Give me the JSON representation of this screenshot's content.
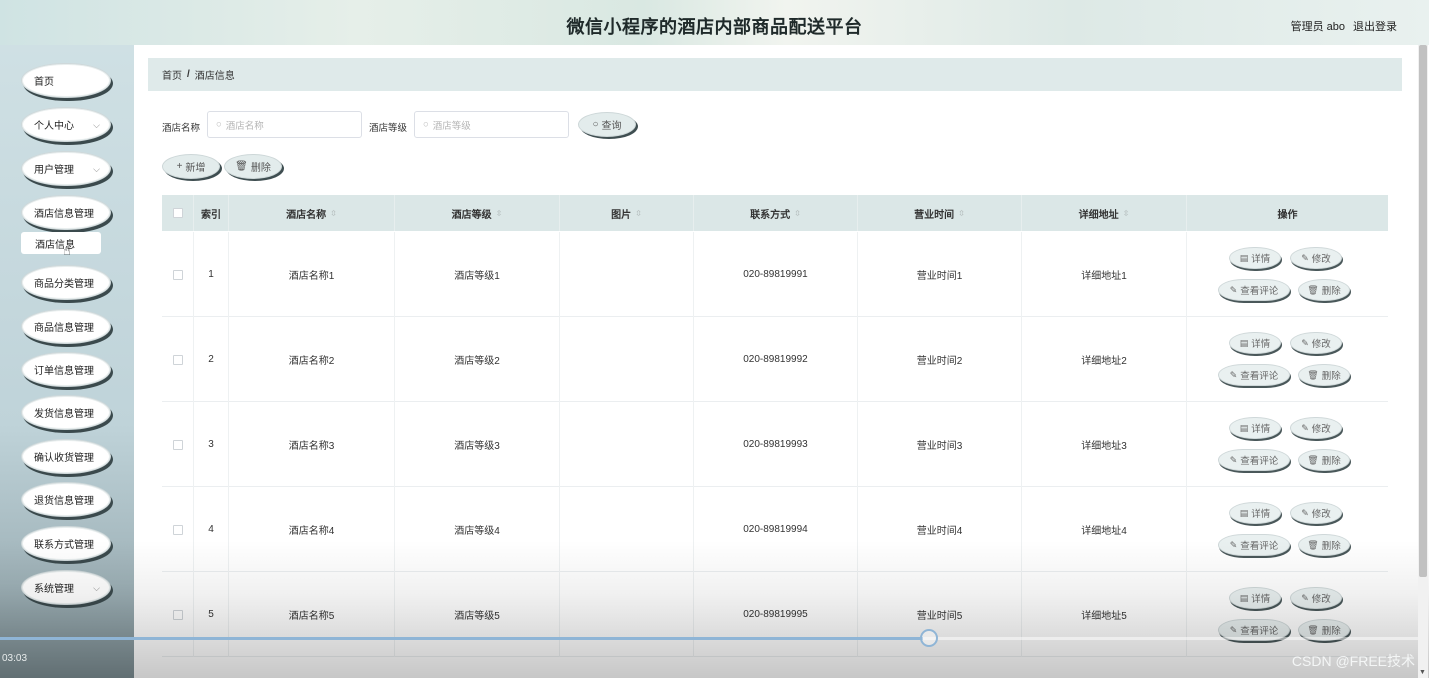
{
  "header": {
    "title": "微信小程序的酒店内部商品配送平台",
    "user_label": "管理员 abo",
    "logout_label": "退出登录"
  },
  "sidebar": {
    "items": [
      {
        "label": "首页",
        "has_chevron": false
      },
      {
        "label": "个人中心",
        "has_chevron": true
      },
      {
        "label": "用户管理",
        "has_chevron": true
      },
      {
        "label": "酒店信息管理",
        "has_chevron": false
      },
      {
        "label": "商品分类管理",
        "has_chevron": false
      },
      {
        "label": "商品信息管理",
        "has_chevron": false
      },
      {
        "label": "订单信息管理",
        "has_chevron": false
      },
      {
        "label": "发货信息管理",
        "has_chevron": false
      },
      {
        "label": "确认收货管理",
        "has_chevron": false
      },
      {
        "label": "退货信息管理",
        "has_chevron": false
      },
      {
        "label": "联系方式管理",
        "has_chevron": false
      },
      {
        "label": "系统管理",
        "has_chevron": true
      }
    ],
    "active_submenu": "酒店信息"
  },
  "breadcrumb": {
    "home": "首页",
    "separator": "/",
    "current": "酒店信息"
  },
  "search": {
    "name_label": "酒店名称",
    "name_placeholder": "酒店名称",
    "level_label": "酒店等级",
    "level_placeholder": "酒店等级",
    "query_button": "查询"
  },
  "toolbar": {
    "add_button": "新增",
    "delete_button": "删除"
  },
  "table": {
    "columns": [
      "索引",
      "酒店名称",
      "酒店等级",
      "图片",
      "联系方式",
      "营业时间",
      "详细地址",
      "操作"
    ],
    "rows": [
      {
        "index": "1",
        "name": "酒店名称1",
        "level": "酒店等级1",
        "image": "",
        "phone": "020-89819991",
        "hours": "营业时间1",
        "address": "详细地址1"
      },
      {
        "index": "2",
        "name": "酒店名称2",
        "level": "酒店等级2",
        "image": "",
        "phone": "020-89819992",
        "hours": "营业时间2",
        "address": "详细地址2"
      },
      {
        "index": "3",
        "name": "酒店名称3",
        "level": "酒店等级3",
        "image": "",
        "phone": "020-89819993",
        "hours": "营业时间3",
        "address": "详细地址3"
      },
      {
        "index": "4",
        "name": "酒店名称4",
        "level": "酒店等级4",
        "image": "",
        "phone": "020-89819994",
        "hours": "营业时间4",
        "address": "详细地址4"
      },
      {
        "index": "5",
        "name": "酒店名称5",
        "level": "酒店等级5",
        "image": "",
        "phone": "020-89819995",
        "hours": "营业时间5",
        "address": "详细地址5"
      }
    ],
    "actions": {
      "detail": "详情",
      "edit": "修改",
      "view_comments": "查看评论",
      "delete": "删除"
    }
  },
  "video": {
    "elapsed": "03:03",
    "progress": 0.65,
    "watermark": "CSDN @FREE技术"
  },
  "colors": {
    "header_bg": "#dfebe8",
    "sidebar_bg": "#c7dade",
    "table_header_bg": "#dbe7e7",
    "progress": "#8fb5d6"
  }
}
